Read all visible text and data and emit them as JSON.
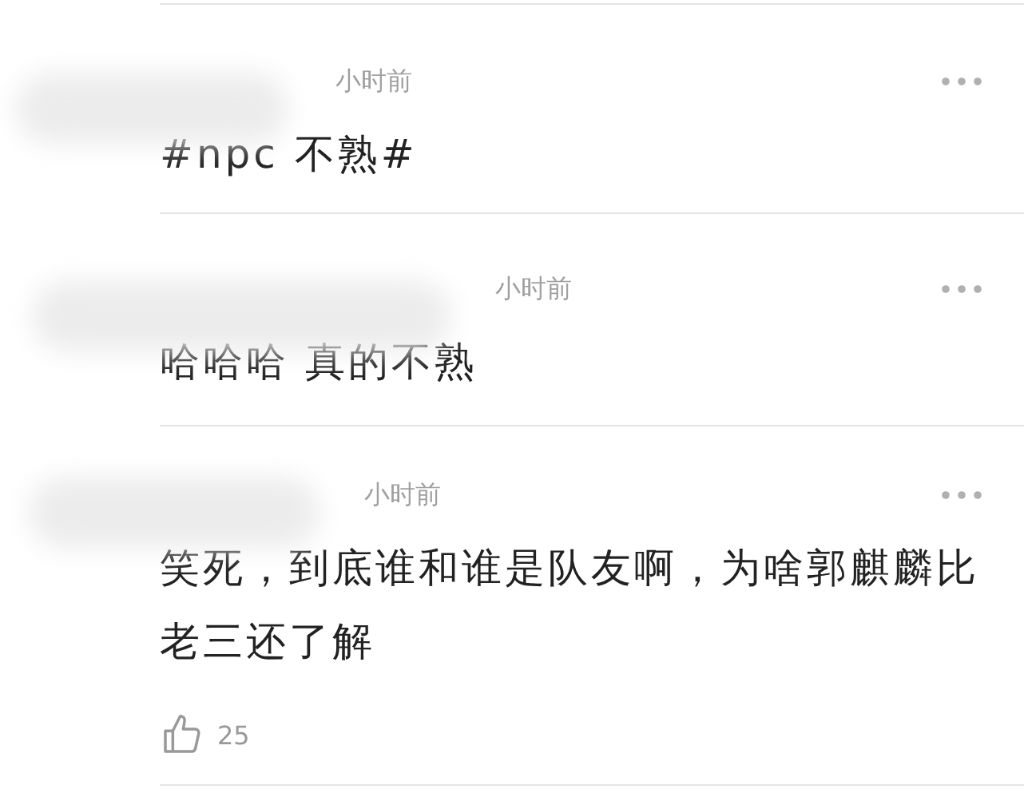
{
  "comments": [
    {
      "time": "小时前",
      "text": "#npc 不熟#"
    },
    {
      "time": "小时前",
      "text": "哈哈哈 真的不熟"
    },
    {
      "time": "小时前",
      "text": "笑死，到底谁和谁是队友啊，为啥郭麒麟比老三还了解",
      "likes": "25"
    }
  ]
}
